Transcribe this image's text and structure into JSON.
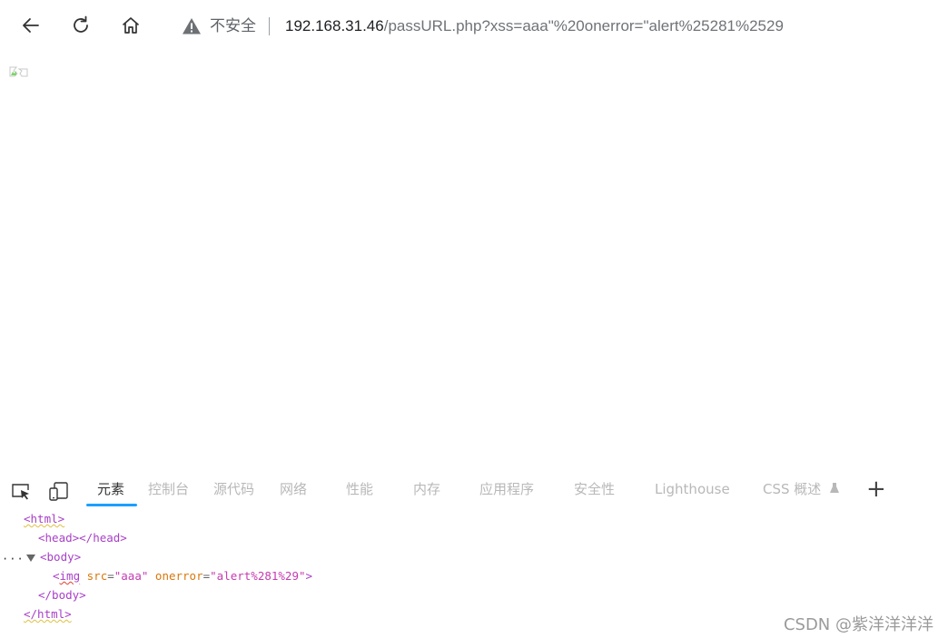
{
  "browser": {
    "security_label": "不安全",
    "url_host": "192.168.31.46",
    "url_path": "/passURL.php?xss=aaa\"%20onerror=\"alert%25281%2529"
  },
  "devtools": {
    "tabs": [
      {
        "label": "元素",
        "active": true
      },
      {
        "label": "控制台"
      },
      {
        "label": "源代码"
      },
      {
        "label": "网络"
      },
      {
        "label": "性能"
      },
      {
        "label": "内存"
      },
      {
        "label": "应用程序"
      },
      {
        "label": "安全性"
      },
      {
        "label": "Lighthouse"
      },
      {
        "label": "CSS 概述"
      }
    ],
    "dom": {
      "html_open": "<html>",
      "head": "<head></head>",
      "body_open": "<body>",
      "img_open": "<",
      "img_tag": "img",
      "img_src_attr": "src",
      "img_src_val": "\"aaa\"",
      "img_onerror_attr": "onerror",
      "img_onerror_val": "\"alert%281%29\"",
      "img_close": ">",
      "body_close": "</body>",
      "html_close": "</html>",
      "ellipsis": "···"
    }
  },
  "watermark": "CSDN @紫洋洋洋洋",
  "colors": {
    "accent": "#1a9fff",
    "tag": "#a83fc7",
    "attr": "#d9770b",
    "val": "#c53bb0"
  }
}
